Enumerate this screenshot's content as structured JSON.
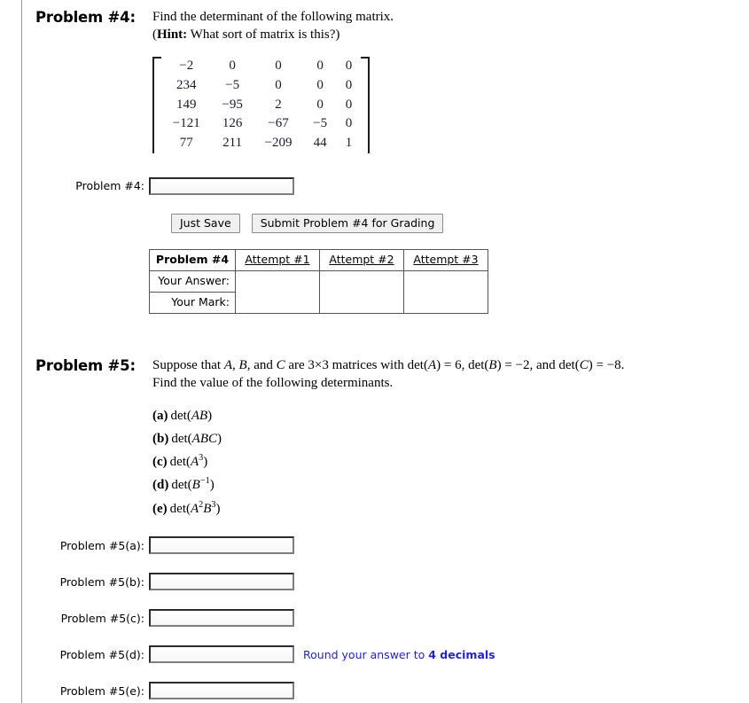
{
  "problem4": {
    "heading": "Problem #4:",
    "statement": "Find the determinant of the following matrix.",
    "hint_label": "Hint:",
    "hint_text": "What sort of matrix is this?)",
    "hint_open_paren": "(",
    "matrix": [
      [
        "−2",
        "0",
        "0",
        "0",
        "0"
      ],
      [
        "234",
        "−5",
        "0",
        "0",
        "0"
      ],
      [
        "149",
        "−95",
        "2",
        "0",
        "0"
      ],
      [
        "−121",
        "126",
        "−67",
        "−5",
        "0"
      ],
      [
        "77",
        "211",
        "−209",
        "44",
        "1"
      ]
    ],
    "answer_label": "Problem #4:",
    "answer_value": "",
    "answer_placeholder": "",
    "buttons": {
      "just_save": "Just Save",
      "submit": "Submit Problem #4 for Grading"
    },
    "attempts_table": {
      "corner_label": "Problem #4",
      "row_labels": [
        "Your Answer:",
        "Your Mark:"
      ],
      "attempt_headers": [
        "Attempt #1",
        "Attempt #2",
        "Attempt #3"
      ],
      "cells": [
        [
          "",
          "",
          ""
        ],
        [
          "",
          "",
          ""
        ]
      ]
    }
  },
  "problem5": {
    "heading": "Problem #5:",
    "line1_parts": {
      "t1": "Suppose that ",
      "a": "A",
      "t2": ", ",
      "b": "B",
      "t3": ", and ",
      "c": "C",
      "t4": " are 3×3 matrices with det(",
      "a2": "A",
      "t5": ") = 6, det(",
      "b2": "B",
      "t6": ") = −2, and det(",
      "c2": "C",
      "t7": ") = −8."
    },
    "line2": "Find the value of the following determinants.",
    "items": [
      {
        "marker": "(a)",
        "func": "det(",
        "base1": "A",
        "exp1": "",
        "base2": "B",
        "exp2": "",
        "close": ")"
      },
      {
        "marker": "(b)",
        "func": "det(",
        "base1": "A",
        "exp1": "",
        "base2": "BC",
        "exp2": "",
        "close": ")"
      },
      {
        "marker": "(c)",
        "func": "det(",
        "base1": "A",
        "exp1": "3",
        "base2": "",
        "exp2": "",
        "close": ")"
      },
      {
        "marker": "(d)",
        "func": "det(",
        "base1": "B",
        "exp1": "−1",
        "base2": "",
        "exp2": "",
        "close": ")"
      },
      {
        "marker": "(e)",
        "func": "det(",
        "base1": "A",
        "exp1": "2",
        "base2": "B",
        "exp2": "3",
        "close": ")"
      }
    ],
    "answers": [
      {
        "label": "Problem #5(a):",
        "value": "",
        "note": "",
        "note_bold": ""
      },
      {
        "label": "Problem #5(b):",
        "value": "",
        "note": "",
        "note_bold": ""
      },
      {
        "label": "Problem #5(c):",
        "value": "",
        "note": "",
        "note_bold": ""
      },
      {
        "label": "Problem #5(d):",
        "value": "",
        "note": "Round your answer to ",
        "note_bold": "4 decimals"
      },
      {
        "label": "Problem #5(e):",
        "value": "",
        "note": "",
        "note_bold": ""
      }
    ]
  },
  "colors": {
    "note_blue": "#2323d0",
    "matrix_ink": "#1a1a33",
    "rule_gray": "#9a9a9a"
  }
}
